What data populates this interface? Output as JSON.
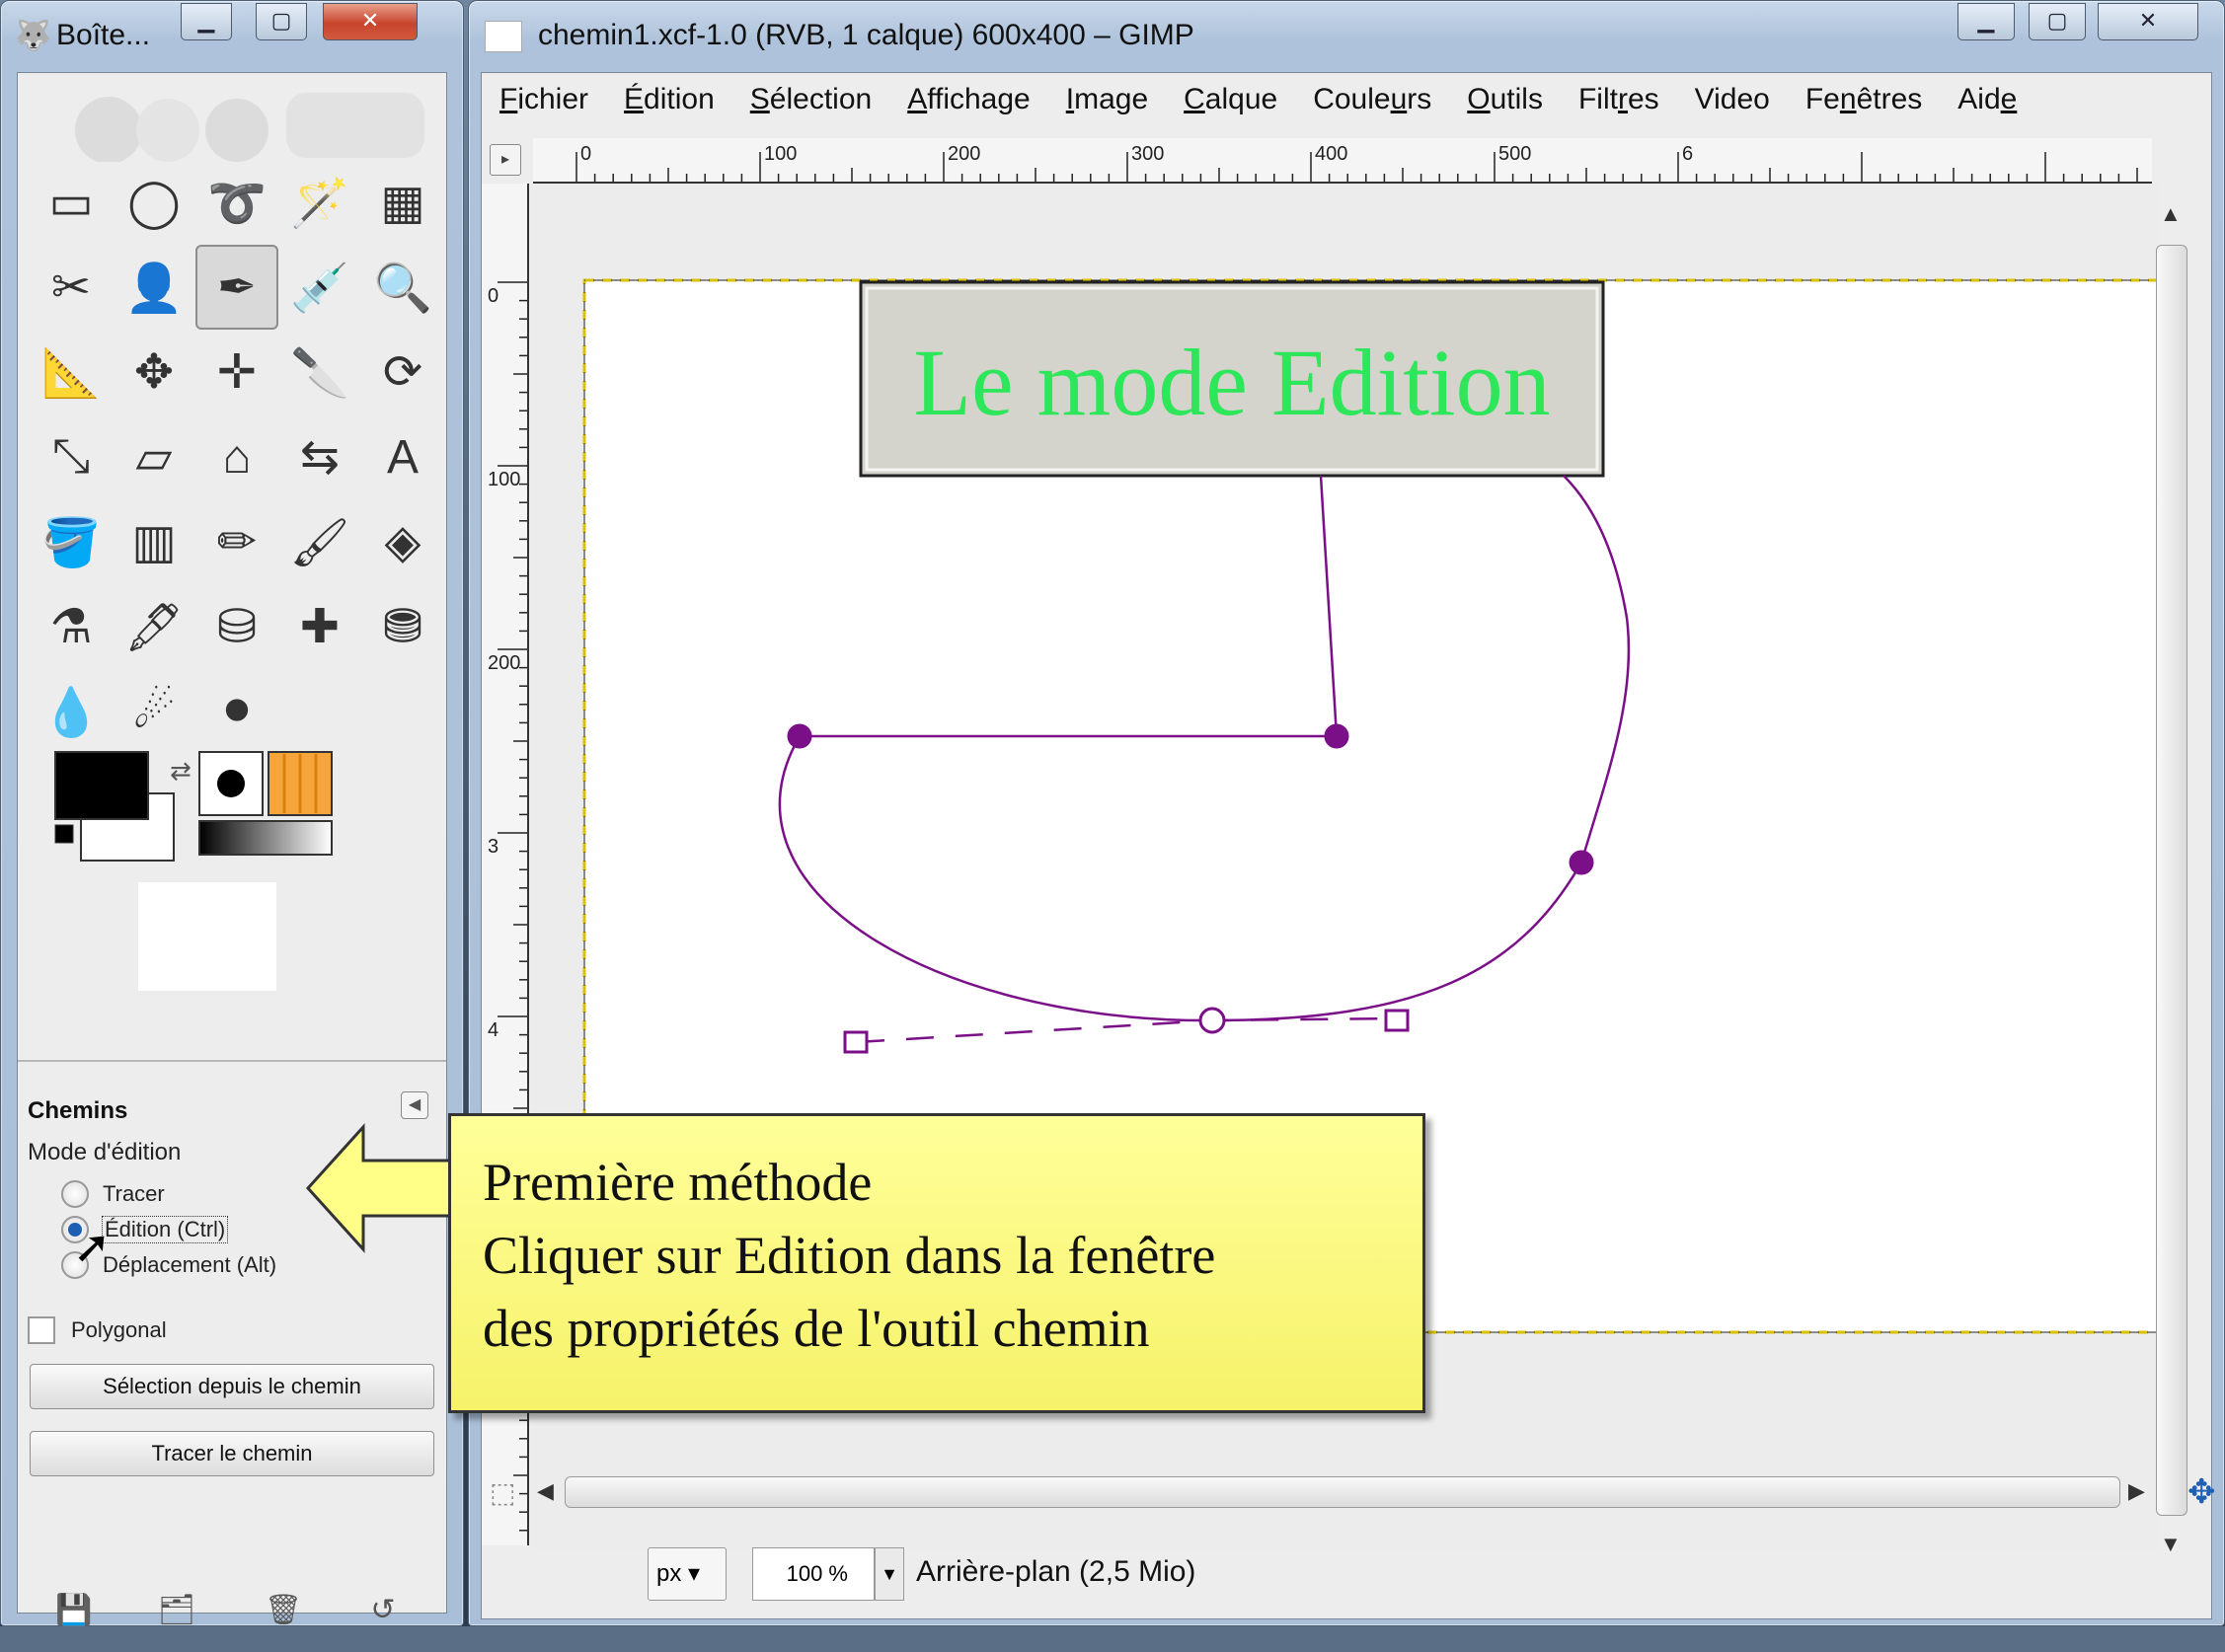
{
  "toolbox": {
    "title": "Boîte...",
    "tools": [
      "rect-select-icon",
      "ellipse-select-icon",
      "lasso-icon",
      "fuzzy-select-icon",
      "select-by-color-icon",
      "scissors-icon",
      "foreground-select-icon",
      "paths-icon",
      "color-picker-icon",
      "zoom-icon",
      "measure-icon",
      "move-icon",
      "align-icon",
      "crop-icon",
      "rotate-icon",
      "scale-icon",
      "shear-icon",
      "perspective-icon",
      "flip-icon",
      "text-icon",
      "bucket-fill-icon",
      "blend-icon",
      "pencil-icon",
      "paintbrush-icon",
      "eraser-icon",
      "airbrush-icon",
      "ink-icon",
      "clone-icon",
      "heal-icon",
      "perspective-clone-icon",
      "blur-icon",
      "smudge-icon",
      "dodge-burn-icon"
    ],
    "tool_glyphs": [
      "▭",
      "◯",
      "➰",
      "🪄",
      "▦",
      "✂",
      "👤",
      "✒",
      "💉",
      "🔍",
      "📐",
      "✥",
      "✛",
      "🔪",
      "⟳",
      "⤡",
      "▱",
      "⌂",
      "⇆",
      "A",
      "🪣",
      "▥",
      "✏",
      "🖌",
      "◈",
      "⚗",
      "🖋",
      "⛁",
      "✚",
      "⛃",
      "💧",
      "☄",
      "⚫"
    ],
    "tool_options": {
      "title": "Chemins",
      "mode_label": "Mode d'édition",
      "mode_options": [
        "Tracer",
        "Édition (Ctrl)",
        "Déplacement (Alt)"
      ],
      "selected_mode": "Édition (Ctrl)",
      "polygonal_label": "Polygonal",
      "polygonal_checked": false,
      "selection_button": "Sélection depuis le chemin",
      "stroke_button": "Tracer le chemin"
    }
  },
  "image_window": {
    "title": "chemin1.xcf-1.0 (RVB, 1 calque) 600x400 – GIMP",
    "menus": [
      {
        "pre": "",
        "mnem": "F",
        "post": "ichier"
      },
      {
        "pre": "",
        "mnem": "É",
        "post": "dition"
      },
      {
        "pre": "",
        "mnem": "S",
        "post": "élection"
      },
      {
        "pre": "",
        "mnem": "A",
        "post": "ffichage"
      },
      {
        "pre": "",
        "mnem": "I",
        "post": "mage"
      },
      {
        "pre": "",
        "mnem": "C",
        "post": "alque"
      },
      {
        "pre": "Coule",
        "mnem": "u",
        "post": "rs"
      },
      {
        "pre": "",
        "mnem": "O",
        "post": "utils"
      },
      {
        "pre": "Filt",
        "mnem": "r",
        "post": "es"
      },
      {
        "pre": "",
        "mnem": "",
        "post": "Video"
      },
      {
        "pre": "Fe",
        "mnem": "n",
        "post": "êtres"
      },
      {
        "pre": "Aid",
        "mnem": "e",
        "post": ""
      }
    ],
    "hruler_labels": [
      "0",
      "100",
      "200",
      "300",
      "400",
      "500",
      "6"
    ],
    "vruler_labels": [
      "0",
      "100",
      "200",
      "3",
      "4"
    ],
    "canvas_title": "Le mode Edition",
    "status": {
      "unit": "px",
      "zoom": "100 %",
      "layer_info": "Arrière-plan (2,5 Mio)"
    }
  },
  "callout": {
    "lines": [
      "Première méthode",
      "Cliquer sur Edition dans la fenêtre",
      "des propriétés de l'outil chemin"
    ]
  },
  "colors": {
    "path": "#7a0f88",
    "title_text": "#2ee65a",
    "callout_bg": "#ffff88",
    "selection_border": "#d9c000"
  }
}
